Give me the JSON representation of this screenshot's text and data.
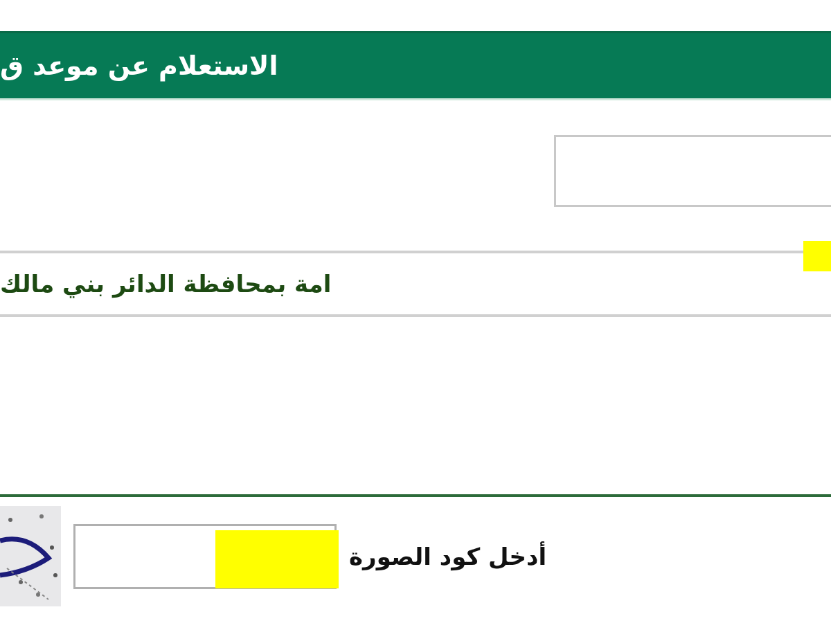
{
  "header": {
    "title": "الاستعلام عن موعد ق"
  },
  "location": {
    "text": "امة بمحافظة الدائر بني مالك"
  },
  "captcha": {
    "label": "أدخل كود الصورة"
  }
}
